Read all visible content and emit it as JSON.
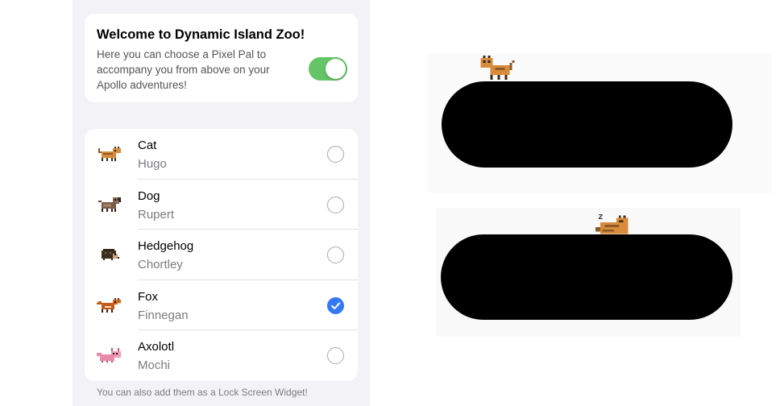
{
  "welcome": {
    "title": "Welcome to Dynamic Island Zoo!",
    "description": "Here you can choose a Pixel Pal to accompany you from above on your Apollo adventures!",
    "toggle_on": true
  },
  "pals": [
    {
      "species": "Cat",
      "name": "Hugo",
      "selected": false,
      "icon": "cat-sprite-icon"
    },
    {
      "species": "Dog",
      "name": "Rupert",
      "selected": false,
      "icon": "dog-sprite-icon"
    },
    {
      "species": "Hedgehog",
      "name": "Chortley",
      "selected": false,
      "icon": "hedgehog-sprite-icon"
    },
    {
      "species": "Fox",
      "name": "Finnegan",
      "selected": true,
      "icon": "fox-sprite-icon"
    },
    {
      "species": "Axolotl",
      "name": "Mochi",
      "selected": false,
      "icon": "axolotl-sprite-icon"
    }
  ],
  "footer": {
    "note": "You can also add them as a Lock Screen Widget!"
  },
  "preview": {
    "sleep_label": "z"
  },
  "colors": {
    "toggle_on": "#65c466",
    "radio_selected": "#3478f6",
    "group_background": "#f2f2f7"
  }
}
